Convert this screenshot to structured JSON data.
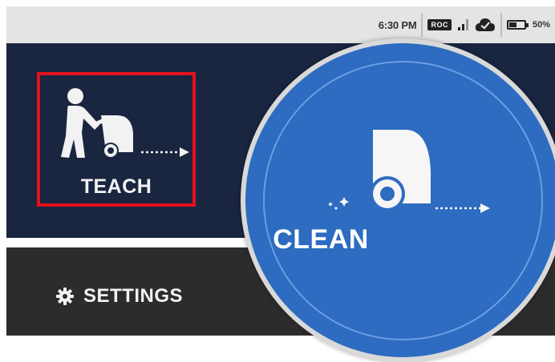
{
  "status_bar": {
    "time": "6:30 PM",
    "roc_badge": "ROC",
    "battery_percent": "50%",
    "battery_level": 0.5,
    "icons": [
      "roc-badge-icon",
      "signal-icon",
      "cloud-check-icon",
      "battery-icon"
    ]
  },
  "teach": {
    "label": "TEACH",
    "icon": "person-pushing-scrubber-icon",
    "highlight_color": "#e3111b"
  },
  "clean": {
    "label": "CLEAN",
    "icon": "scrubber-robot-icon",
    "color": "#2d6cc0"
  },
  "settings": {
    "label": "SETTINGS",
    "icon": "gear-icon"
  },
  "colors": {
    "navy_panel": "#1a2540",
    "dark_panel": "#2c2c2c",
    "status_bar": "#e4e4e2"
  }
}
